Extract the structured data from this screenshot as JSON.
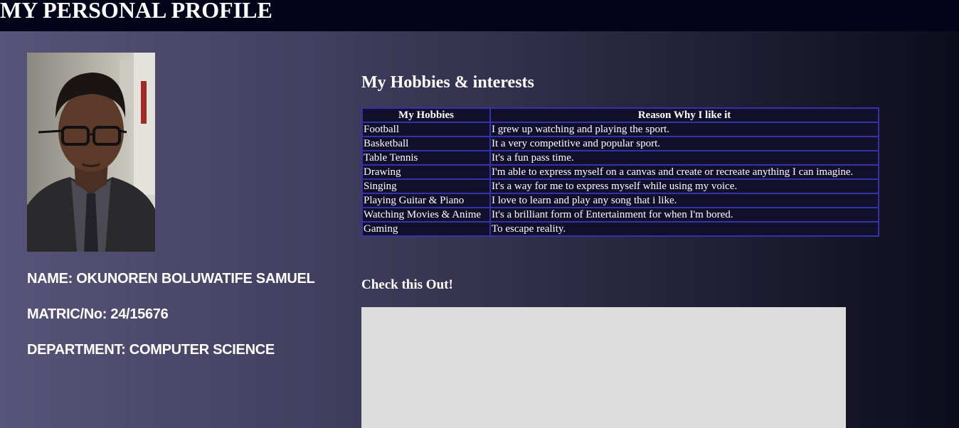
{
  "header": {
    "title": "MY PERSONAL PROFILE"
  },
  "profile": {
    "photo_alt": "Profile photo",
    "name": "NAME: OKUNOREN BOLUWATIFE SAMUEL",
    "matric": "MATRIC/No: 24/15676",
    "department": "DEPARTMENT: COMPUTER SCIENCE"
  },
  "hobbies": {
    "title": "My Hobbies & interests",
    "headers": [
      "My Hobbies",
      "Reason Why I like it"
    ],
    "rows": [
      [
        "Football",
        "I grew up watching and playing the sport."
      ],
      [
        "Basketball",
        "It a very competitive and popular sport."
      ],
      [
        "Table Tennis",
        "It's a fun pass time."
      ],
      [
        "Drawing",
        "I'm able to express myself on a canvas and create or recreate anything I can imagine."
      ],
      [
        "Singing",
        "It's a way for me to express myself while using my voice."
      ],
      [
        "Playing Guitar & Piano",
        "I love to learn and play any song that i like."
      ],
      [
        "Watching Movies & Anime",
        "It's a brilliant form of Entertainment for when I'm bored."
      ],
      [
        "Gaming",
        "To escape reality."
      ]
    ]
  },
  "check": {
    "title": "Check this Out!"
  },
  "colors": {
    "header_bg": "#03031a",
    "table_bg": "#120f2c",
    "table_border": "#3332a8",
    "video_placeholder": "#dcdcdc"
  }
}
